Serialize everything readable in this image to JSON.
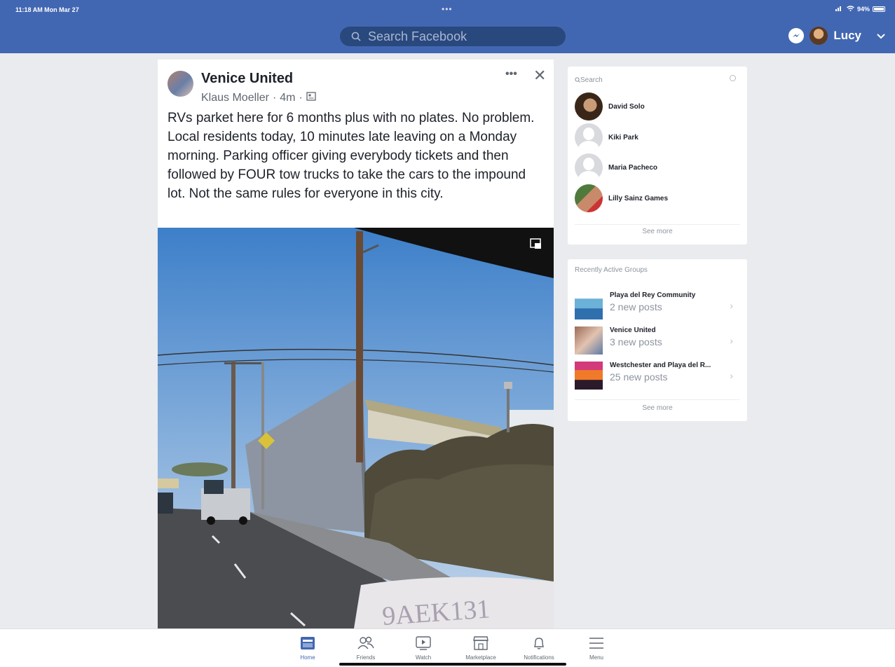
{
  "status_bar": {
    "time": "11:18 AM  Mon Mar 27",
    "battery": "94%"
  },
  "header": {
    "search_placeholder": "Search Facebook",
    "user_name": "Lucy",
    "brand_color": "#4267b2"
  },
  "post": {
    "group_name": "Venice United",
    "author": "Klaus Moeller",
    "time": "4m",
    "more": "•••",
    "close": "✕",
    "text": "RVs parket here for 6 months plus with no plates. No problem. Local residents today, 10 minutes late leaving on a Monday morning. Parking officer giving everybody tickets and then followed by FOUR tow trucks to take the cars to the impound lot. Not the same rules for everyone in this city.",
    "photo_overlay_text": "9AEK131"
  },
  "contacts": {
    "search_placeholder": "Search",
    "items": [
      {
        "name": "David Solo"
      },
      {
        "name": "Kiki Park"
      },
      {
        "name": "Maria Pacheco"
      },
      {
        "name": "Lilly Sainz Games"
      }
    ],
    "see_more": "See more"
  },
  "groups": {
    "title": "Recently Active Groups",
    "items": [
      {
        "name": "Playa del Rey Community",
        "posts": "2 new posts"
      },
      {
        "name": "Venice United",
        "posts": "3 new posts"
      },
      {
        "name": "Westchester and Playa del R...",
        "posts": "25 new posts"
      }
    ],
    "see_more": "See more"
  },
  "tabbar": {
    "tabs": [
      {
        "label": "Home",
        "icon": "home-icon"
      },
      {
        "label": "Friends",
        "icon": "friends-icon"
      },
      {
        "label": "Watch",
        "icon": "watch-icon"
      },
      {
        "label": "Marketplace",
        "icon": "marketplace-icon"
      },
      {
        "label": "Notifications",
        "icon": "bell-icon"
      },
      {
        "label": "Menu",
        "icon": "menu-icon"
      }
    ],
    "active": "Home"
  }
}
